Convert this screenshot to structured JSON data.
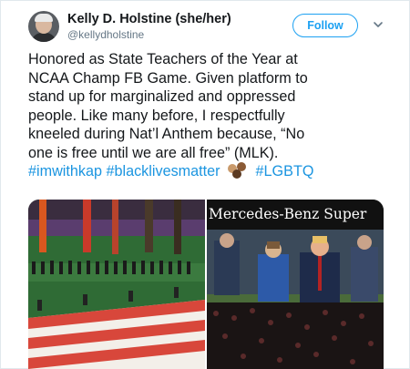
{
  "tweet": {
    "author": {
      "display_name": "Kelly D. Holstine (she/her)",
      "handle": "@kellydholstine"
    },
    "follow_label": "Follow",
    "text_lines": [
      "Honored as State Teachers of the Year at",
      "NCAA Champ FB Game. Given platform to",
      "stand up for marginalized and oppressed",
      "people. Like many before, I respectfully",
      "kneeled during Nat’l Anthem because, “No",
      "one is free until we are all free” (MLK)."
    ],
    "hashtags": [
      "#imwithkap",
      "#blacklivesmatter",
      "#LGBTQ"
    ],
    "emoji": "raised-fist-emoji",
    "media": {
      "right_banner_text": "Mercedes-Benz Super"
    }
  },
  "colors": {
    "accent": "#1da1f2",
    "link": "#1b95e0",
    "text": "#14171a",
    "secondary_text": "#657786"
  },
  "icons": [
    "caret-down-icon"
  ]
}
